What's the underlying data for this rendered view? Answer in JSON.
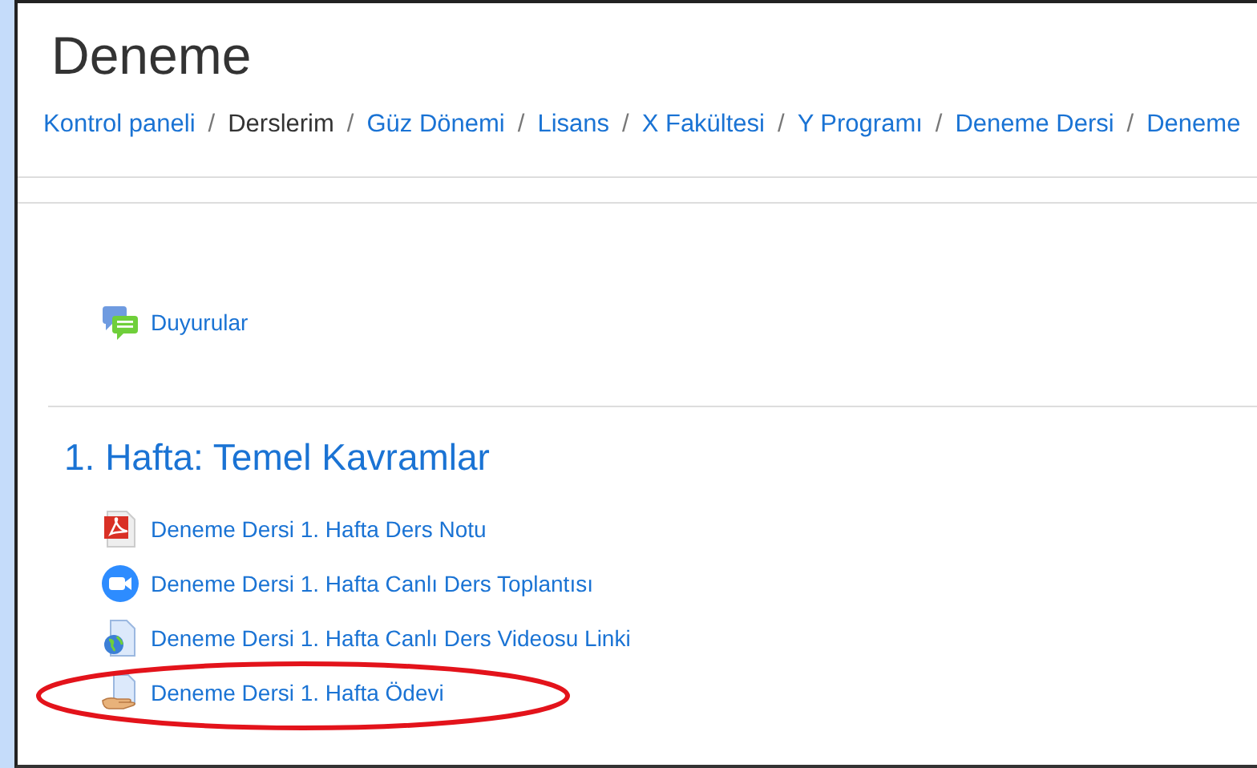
{
  "page": {
    "title": "Deneme"
  },
  "breadcrumb": [
    {
      "label": "Kontrol paneli",
      "link": true
    },
    {
      "label": "Derslerim",
      "link": false
    },
    {
      "label": "Güz Dönemi",
      "link": true
    },
    {
      "label": "Lisans",
      "link": true
    },
    {
      "label": "X Fakültesi",
      "link": true
    },
    {
      "label": "Y Programı",
      "link": true
    },
    {
      "label": "Deneme Dersi",
      "link": true
    },
    {
      "label": "Deneme",
      "link": true
    }
  ],
  "breadcrumb_separator": "/",
  "general_section": {
    "activities": [
      {
        "kind": "forum",
        "label": "Duyurular",
        "highlighted": false
      }
    ]
  },
  "sections": [
    {
      "title": "1. Hafta: Temel Kavramlar",
      "activities": [
        {
          "kind": "pdf",
          "label": "Deneme Dersi 1. Hafta Ders Notu",
          "highlighted": false
        },
        {
          "kind": "meeting",
          "label": "Deneme Dersi 1. Hafta Canlı Ders Toplantısı",
          "highlighted": false
        },
        {
          "kind": "url",
          "label": "Deneme Dersi 1. Hafta Canlı Ders Videosu Linki",
          "highlighted": false
        },
        {
          "kind": "assignment",
          "label": "Deneme Dersi 1. Hafta Ödevi",
          "highlighted": true
        }
      ]
    }
  ]
}
